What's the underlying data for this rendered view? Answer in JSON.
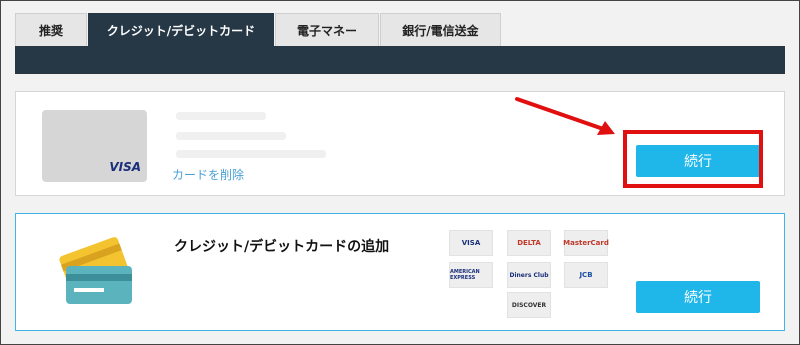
{
  "tabs": [
    {
      "label": "推奨",
      "active": false
    },
    {
      "label": "クレジット/デビットカード",
      "active": true
    },
    {
      "label": "電子マネー",
      "active": false
    },
    {
      "label": "銀行/電信送金",
      "active": false
    }
  ],
  "saved_card": {
    "brand": "VISA",
    "delete_link": "カードを削除",
    "continue_label": "続行"
  },
  "add_card": {
    "title": "クレジット/デビットカードの追加",
    "continue_label": "続行",
    "logos": [
      "VISA",
      "DELTA",
      "MasterCard",
      "AMERICAN EXPRESS",
      "Diners Club",
      "JCB",
      "DISCOVER"
    ]
  },
  "colors": {
    "tab_active": "#263746",
    "button": "#1fb6ea",
    "highlight": "#e01010",
    "link": "#4a9fd6"
  }
}
